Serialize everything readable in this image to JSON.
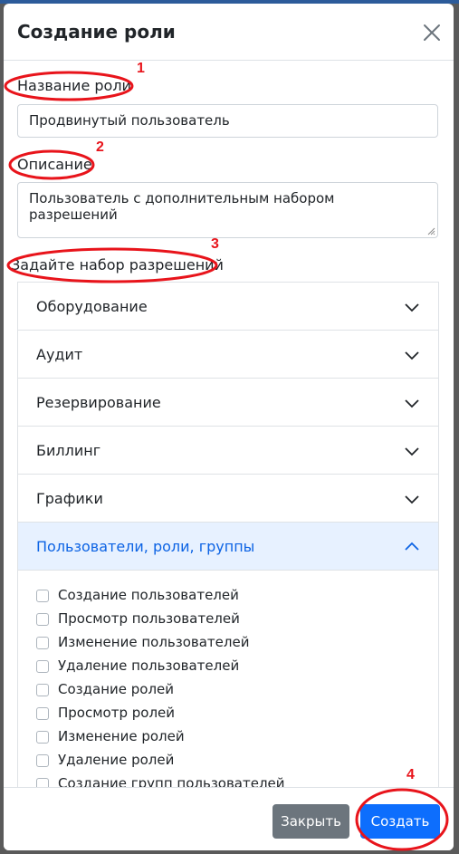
{
  "modal": {
    "title": "Создание роли",
    "fields": {
      "name_label": "Название роли",
      "name_value": "Продвинутый пользователь",
      "description_label": "Описание",
      "description_value": "Пользователь с дополнительным набором разрешений",
      "permissions_label": "Задайте набор разрешений"
    },
    "sections": [
      {
        "label": "Оборудование",
        "expanded": false
      },
      {
        "label": "Аудит",
        "expanded": false
      },
      {
        "label": "Резервирование",
        "expanded": false
      },
      {
        "label": "Биллинг",
        "expanded": false
      },
      {
        "label": "Графики",
        "expanded": false
      },
      {
        "label": "Пользователи, роли, группы",
        "expanded": true
      }
    ],
    "permissions": [
      "Создание пользователей",
      "Просмотр пользователей",
      "Изменение пользователей",
      "Удаление пользователей",
      "Создание ролей",
      "Просмотр ролей",
      "Изменение ролей",
      "Удаление ролей",
      "Создание групп пользователей"
    ],
    "footer": {
      "close_label": "Закрыть",
      "create_label": "Создать"
    }
  },
  "annotations": [
    "1",
    "2",
    "3",
    "4"
  ],
  "colors": {
    "primary": "#0d6efd",
    "secondary": "#6c757d",
    "active_section_bg": "#e7f1ff",
    "annotation": "#e8141b"
  },
  "icons": {
    "close": "close-icon",
    "collapsed": "chevron-down-icon",
    "expanded": "chevron-up-icon",
    "resize": "resize-handle-icon"
  }
}
